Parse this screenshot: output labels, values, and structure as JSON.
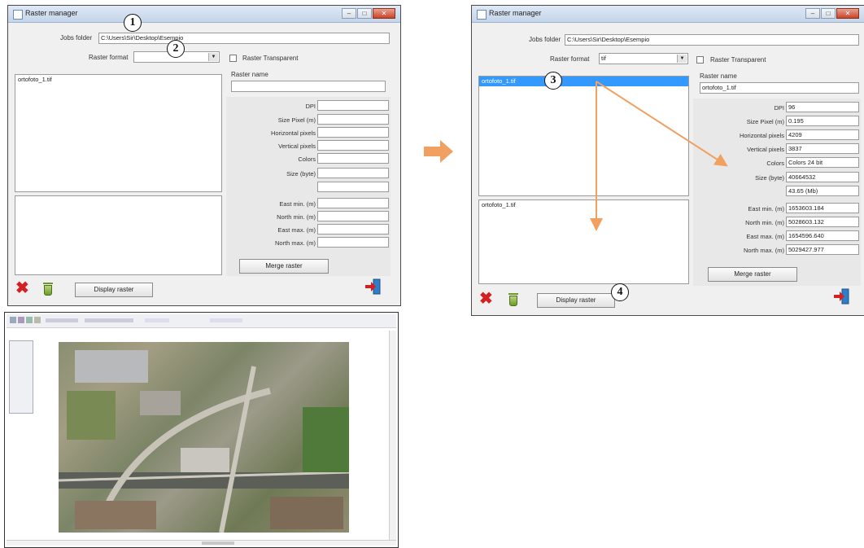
{
  "window_left": {
    "title": "Raster manager",
    "jobs_folder_label": "Jobs folder",
    "jobs_folder_value": "C:\\Users\\Sir\\Desktop\\Esempio",
    "raster_format_label": "Raster format",
    "raster_format_value": "",
    "raster_transparent_label": "Raster Transparent",
    "raster_name_label": "Raster name",
    "raster_name_value": "",
    "file_list": [
      "ortofoto_1.tif"
    ],
    "bottom_list": [],
    "fields": [
      {
        "label": "DPI",
        "value": ""
      },
      {
        "label": "Size Pixel (m)",
        "value": ""
      },
      {
        "label": "Horizontal pixels",
        "value": ""
      },
      {
        "label": "Vertical pixels",
        "value": ""
      },
      {
        "label": "Colors",
        "value": ""
      },
      {
        "label": "Size (byte)",
        "value": ""
      },
      {
        "label": "",
        "value": ""
      },
      {
        "label": "East min. (m)",
        "value": ""
      },
      {
        "label": "North min. (m)",
        "value": ""
      },
      {
        "label": "East max. (m)",
        "value": ""
      },
      {
        "label": "North max. (m)",
        "value": ""
      }
    ],
    "merge_button": "Merge raster",
    "display_button": "Display raster"
  },
  "window_right": {
    "title": "Raster manager",
    "jobs_folder_label": "Jobs folder",
    "jobs_folder_value": "C:\\Users\\Sir\\Desktop\\Esempio",
    "raster_format_label": "Raster format",
    "raster_format_value": "tif",
    "raster_transparent_label": "Raster Transparent",
    "raster_name_label": "Raster name",
    "raster_name_value": "ortofoto_1.tif",
    "file_list": [
      "ortofoto_1.tif"
    ],
    "bottom_list": [
      "ortofoto_1.tif"
    ],
    "fields": [
      {
        "label": "DPI",
        "value": "96"
      },
      {
        "label": "Size Pixel (m)",
        "value": "0.195"
      },
      {
        "label": "Horizontal pixels",
        "value": "4209"
      },
      {
        "label": "Vertical pixels",
        "value": "3837"
      },
      {
        "label": "Colors",
        "value": "Colors 24 bit"
      },
      {
        "label": "Size (byte)",
        "value": "40664532"
      },
      {
        "label": "",
        "value": "43.65 (Mb)"
      },
      {
        "label": "East min. (m)",
        "value": "1653603.184"
      },
      {
        "label": "North min. (m)",
        "value": "5028603.132"
      },
      {
        "label": "East max. (m)",
        "value": "1654596.640"
      },
      {
        "label": "North max. (m)",
        "value": "5029427.977"
      }
    ],
    "merge_button": "Merge raster",
    "display_button": "Display raster"
  },
  "badges": [
    "1",
    "2",
    "3",
    "4"
  ],
  "colors": {
    "arrow": "#f0a060",
    "selection": "#3399ff",
    "delete": "#d42020"
  },
  "icons": [
    "delete-icon",
    "trash-icon",
    "exit-icon",
    "arrow-right-icon"
  ]
}
